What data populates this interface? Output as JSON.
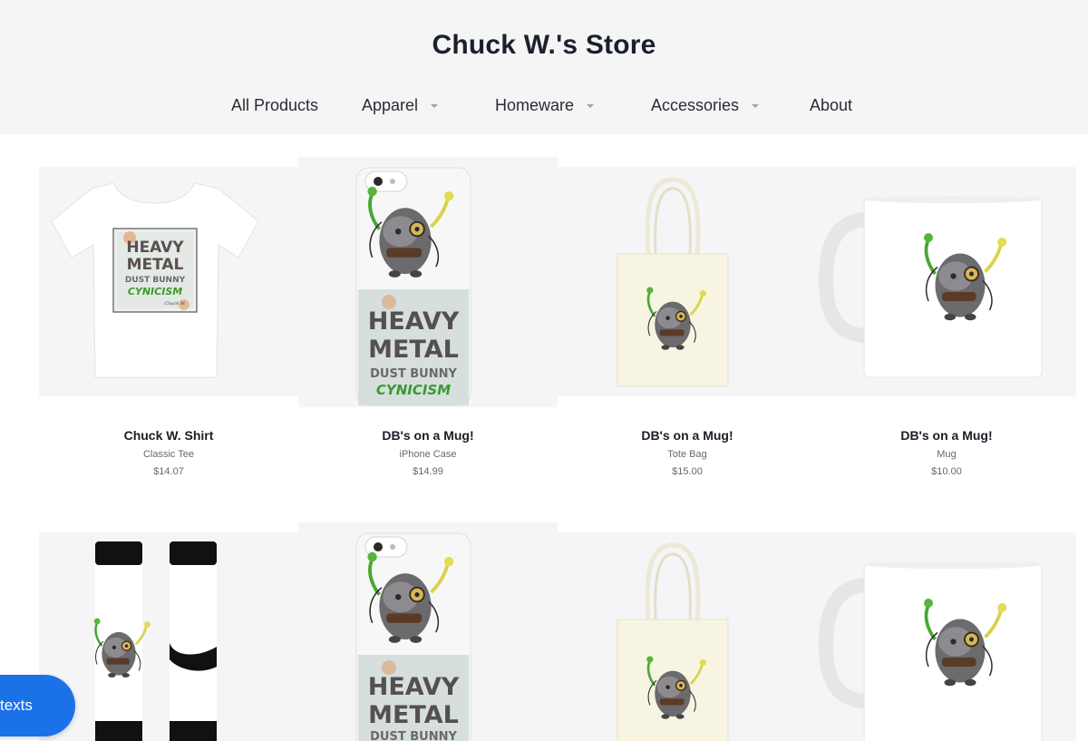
{
  "header": {
    "store_title": "Chuck W.'s Store",
    "nav": [
      {
        "label": "All Products",
        "has_dropdown": false
      },
      {
        "label": "Apparel",
        "has_dropdown": true
      },
      {
        "label": "Homeware",
        "has_dropdown": true
      },
      {
        "label": "Accessories",
        "has_dropdown": true
      },
      {
        "label": "About",
        "has_dropdown": false
      }
    ]
  },
  "products": [
    {
      "name": "Chuck W. Shirt",
      "type": "Classic Tee",
      "price": "$14.07",
      "image": "tshirt"
    },
    {
      "name": "DB's on a Mug!",
      "type": "iPhone Case",
      "price": "$14.99",
      "image": "phone-case"
    },
    {
      "name": "DB's on a Mug!",
      "type": "Tote Bag",
      "price": "$15.00",
      "image": "tote-bag"
    },
    {
      "name": "DB's on a Mug!",
      "type": "Mug",
      "price": "$10.00",
      "image": "mug"
    },
    {
      "name": "",
      "type": "",
      "price": "",
      "image": "socks"
    },
    {
      "name": "",
      "type": "",
      "price": "",
      "image": "phone-case"
    },
    {
      "name": "",
      "type": "",
      "price": "",
      "image": "tote-bag"
    },
    {
      "name": "",
      "type": "",
      "price": "",
      "image": "mug"
    }
  ],
  "artwork_text": {
    "line1": "HEAVY",
    "line2": "METAL",
    "line3": "DUST BUNNY",
    "line4": "CYNICISM",
    "signature": "Chuck W."
  },
  "chat_widget": {
    "label": "texts"
  },
  "colors": {
    "header_bg": "#f4f5f5",
    "card_bg": "#f5f5f7",
    "chat_blue": "#1b72e8",
    "art_green": "#3c9a2a"
  }
}
